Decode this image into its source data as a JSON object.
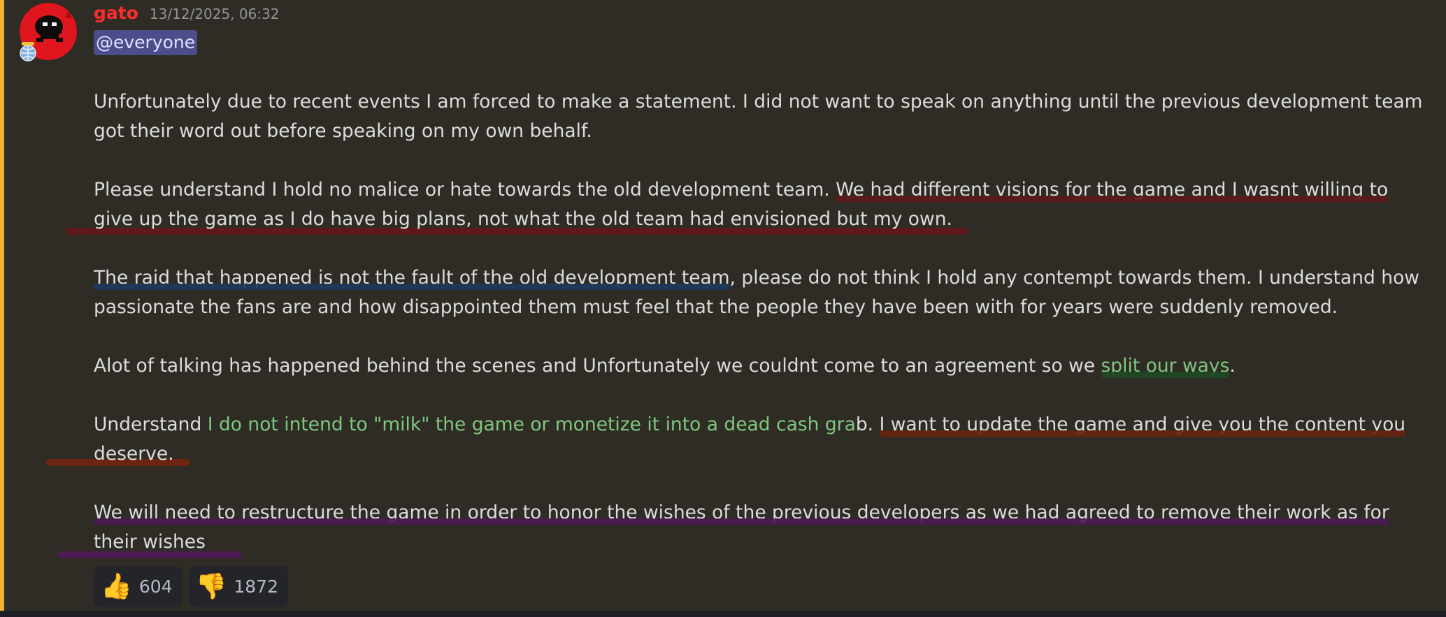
{
  "message": {
    "author": "gato",
    "timestamp": "13/12/2025, 06:32",
    "mention": "@everyone",
    "paragraphs": {
      "p1": {
        "l1": "Unfortunately due to recent events I am forced to make a statement. I did not want to speak on anything until the previous development team",
        "l2": "got their word out before speaking on my own behalf."
      },
      "p2": {
        "l1a": "Please understand I hold no malice or hate towards the old development team. ",
        "l1b": "We had different visions for the game and I wasnt willing to",
        "l2": "give up the game as I do have big plans, not what the old team had envisioned but my own."
      },
      "p3": {
        "l1a": "The raid that happened is not the fault of the old development team",
        "l1b": ", please do not think I hold any contempt towards them. I understand how",
        "l2": "passionate the fans are and how disappointed them must feel that the people they have been with for years were suddenly removed."
      },
      "p4": {
        "l1a": "Alot of talking has happened behind the scenes and Unfortunately we couldnt come to an agreement so we ",
        "l1b": "split our ways",
        "l1c": "."
      },
      "p5": {
        "l1a": "Understand ",
        "l1b": "I do not intend to \"milk\" the game or monetize it into a dead cash gra",
        "l1c": "b. ",
        "l1d": "I want to update the game and give you the content you",
        "l2": "deserve."
      },
      "p6": {
        "l1": "We will need to restructure the game in order to honor the wishes of the previous developers as we had agreed to remove their work as for",
        "l2": "their wishes"
      }
    },
    "reactions": [
      {
        "emoji": "👍",
        "icon": "thumbs-up-icon",
        "count": "604"
      },
      {
        "emoji": "👎",
        "icon": "thumbs-down-icon",
        "count": "1872"
      }
    ]
  },
  "colors": {
    "username": "#ff2b2b",
    "accent_border": "#f0b232",
    "mention_bg": "#4b4e8b",
    "text": "#dcdcdc"
  }
}
